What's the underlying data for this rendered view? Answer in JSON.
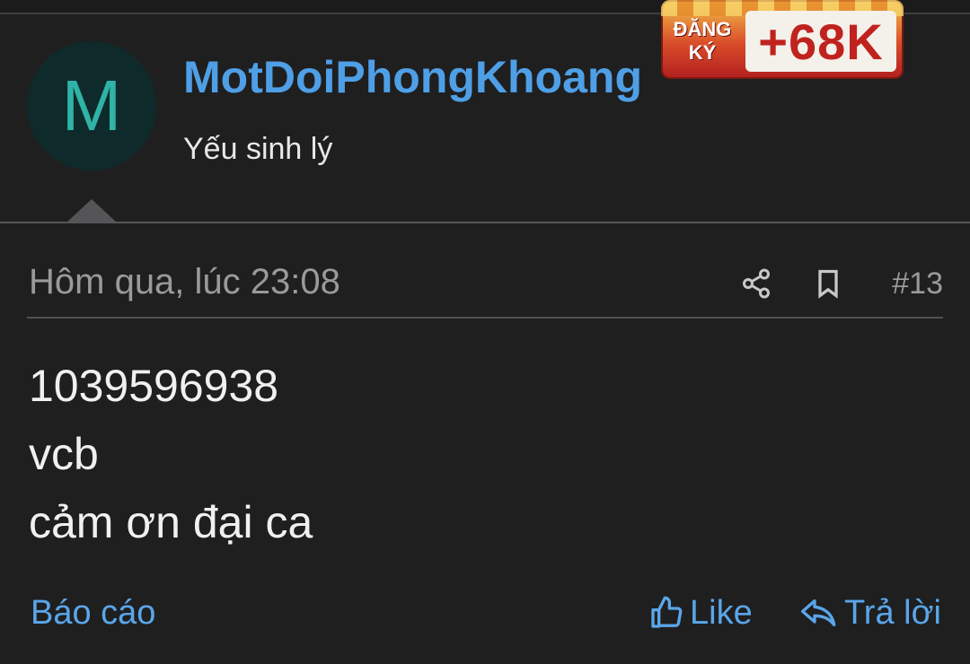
{
  "user": {
    "avatar_letter": "M",
    "username": "MotDoiPhongKhoang",
    "title": "Yếu sinh lý"
  },
  "promo_banner": {
    "label": "ĐĂNG KÝ",
    "amount": "+68K"
  },
  "post": {
    "timestamp": "Hôm qua, lúc 23:08",
    "number": "#13",
    "body_lines": [
      "1039596938",
      "vcb",
      "cảm ơn đại ca"
    ]
  },
  "actions": {
    "report": "Báo cáo",
    "like": "Like",
    "reply": "Trả lời"
  },
  "icons": [
    "share-icon",
    "bookmark-icon",
    "thumbs-up-icon",
    "reply-icon"
  ],
  "colors": {
    "background": "#1f1f20",
    "link": "#5aa6ea",
    "username": "#4f9fe6",
    "avatar_bg": "#0f2a2a",
    "avatar_letter": "#2fb3a6",
    "muted_text": "#9a9a9c"
  }
}
